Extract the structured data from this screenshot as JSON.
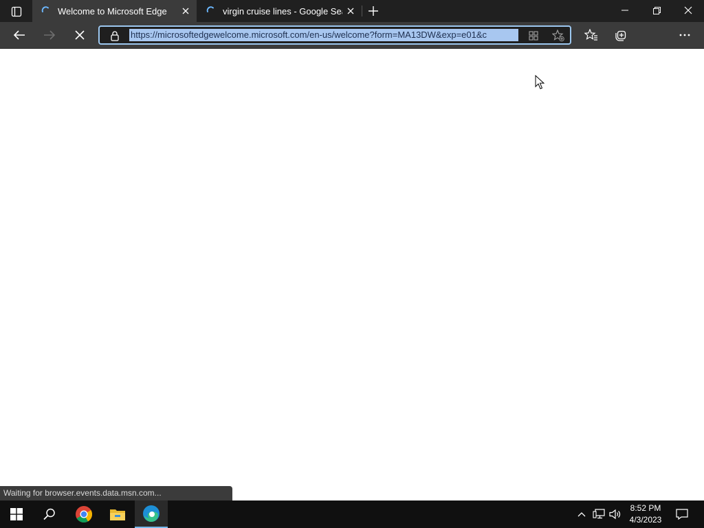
{
  "browser": {
    "tabs": [
      {
        "title": "Welcome to Microsoft Edge",
        "active": true
      },
      {
        "title": "virgin cruise lines - Google Search",
        "active": false
      }
    ],
    "address_url": "https://microsoftedgewelcome.microsoft.com/en-us/welcome?form=MA13DW&exp=e01&c",
    "status_text": "Waiting for browser.events.data.msn.com...",
    "colors": {
      "titlebar": "#202020",
      "toolbar": "#3b3b3b",
      "url_selection": "#a8c7f0",
      "address_focus_border": "#9dc8f0"
    }
  },
  "taskbar": {
    "apps": [
      "windows-start",
      "search",
      "chrome",
      "file-explorer",
      "edge"
    ],
    "time": "8:52 PM",
    "date": "4/3/2023"
  }
}
